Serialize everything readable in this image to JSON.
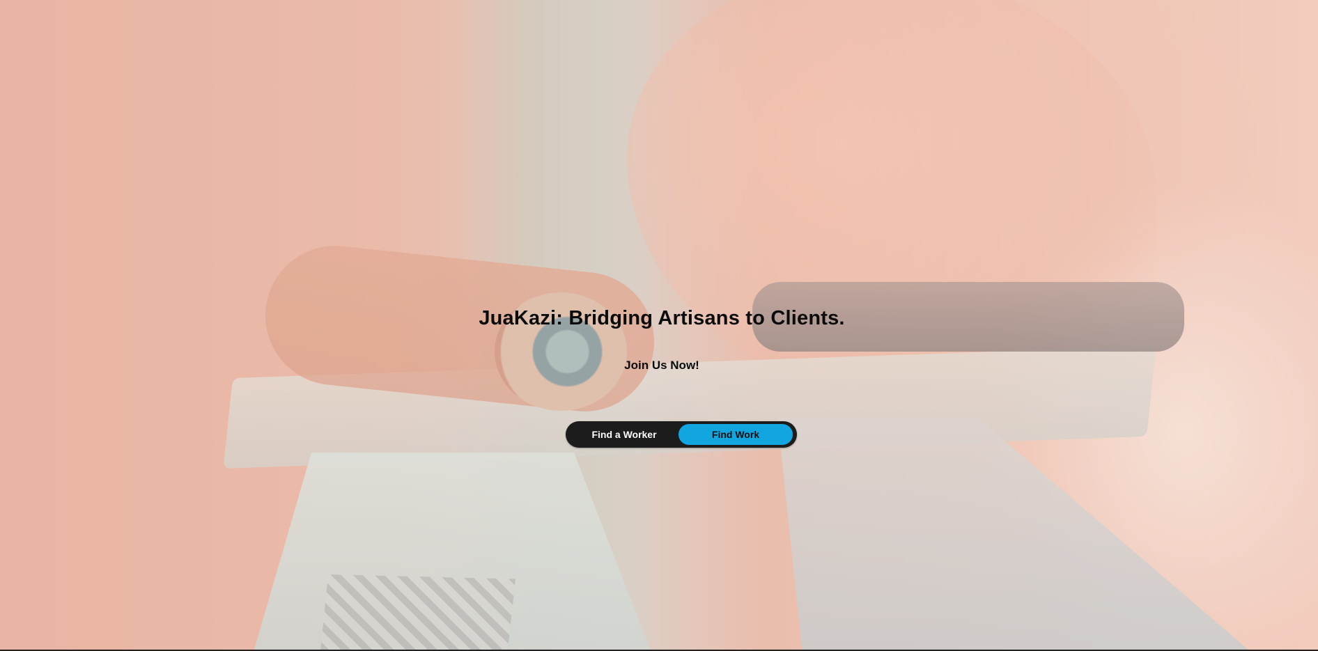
{
  "hero": {
    "title": "JuaKazi: Bridging Artisans to Clients.",
    "subtitle": "Join Us Now!"
  },
  "toggle": {
    "options": [
      {
        "label": "Find a Worker",
        "selected": false
      },
      {
        "label": "Find Work",
        "selected": true
      }
    ],
    "active_color": "#12a6e0",
    "track_color": "#1c1c1c"
  },
  "background": {
    "description_icon": "artisan-tools-background-image",
    "tint": "#e8b4a2"
  }
}
